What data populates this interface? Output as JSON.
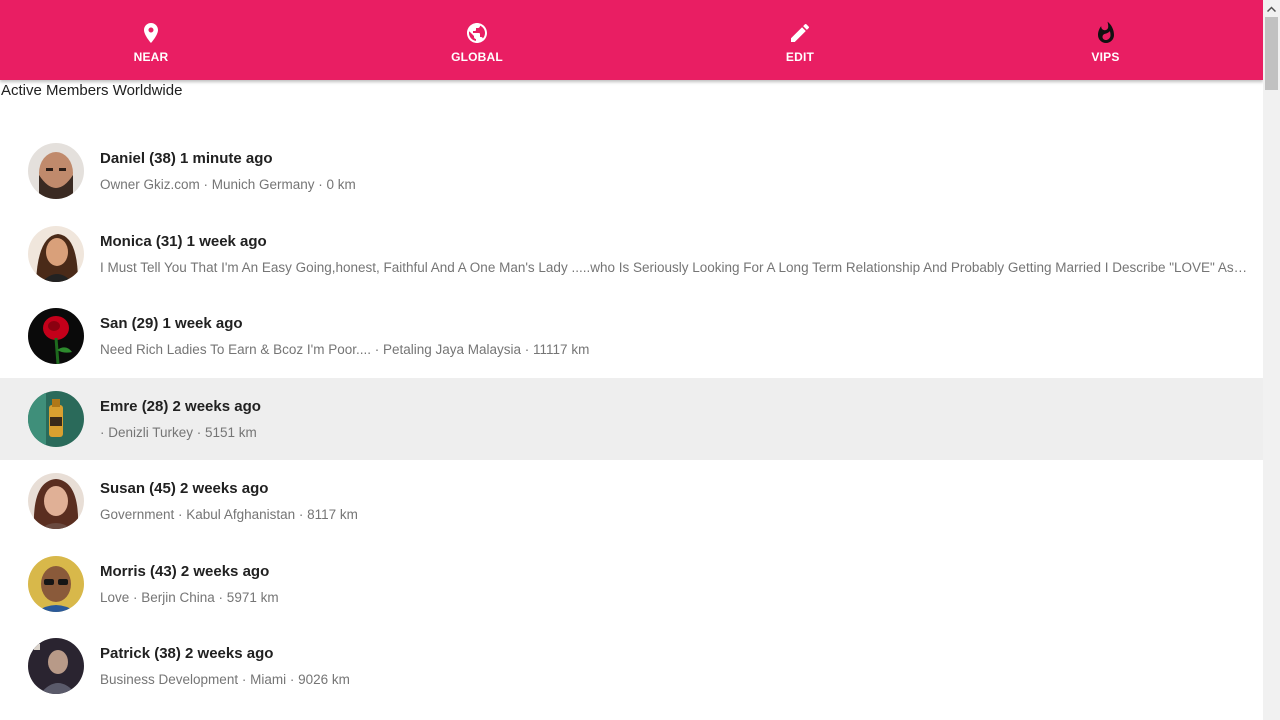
{
  "nav": {
    "tabs": [
      {
        "label": "NEAR",
        "icon": "location-pin-icon"
      },
      {
        "label": "GLOBAL",
        "icon": "globe-icon"
      },
      {
        "label": "EDIT",
        "icon": "pencil-icon"
      },
      {
        "label": "VIPS",
        "icon": "flame-icon"
      }
    ]
  },
  "section_title": "Active Members Worldwide",
  "members": [
    {
      "name": "Daniel (38) 1 minute ago",
      "details": "Owner Gkiz.com · Munich Germany · 0 km"
    },
    {
      "name": "Monica (31) 1 week ago",
      "details": "I Must Tell You That I'm An Easy Going,honest, Faithful And A One Man's Lady .....who Is Seriously Looking For A Long Term Relationship And Probably Getting Married I Describe \"LOVE\" As A Wonderful Feeling"
    },
    {
      "name": "San (29) 1 week ago",
      "details": "Need Rich Ladies To Earn & Bcoz I'm Poor.... · Petaling Jaya Malaysia · 11117 km"
    },
    {
      "name": "Emre (28) 2 weeks ago",
      "details": "· Denizli Turkey · 5151 km"
    },
    {
      "name": "Susan (45) 2 weeks ago",
      "details": "Government · Kabul Afghanistan · 8117 km"
    },
    {
      "name": "Morris (43) 2 weeks ago",
      "details": "Love · Berjin China · 5971 km"
    },
    {
      "name": "Patrick (38) 2 weeks ago",
      "details": "Business Development · Miami · 9026 km"
    }
  ],
  "colors": {
    "accent": "#e91e63",
    "highlight_row": "#eeeeee",
    "secondary_text": "#757575"
  }
}
